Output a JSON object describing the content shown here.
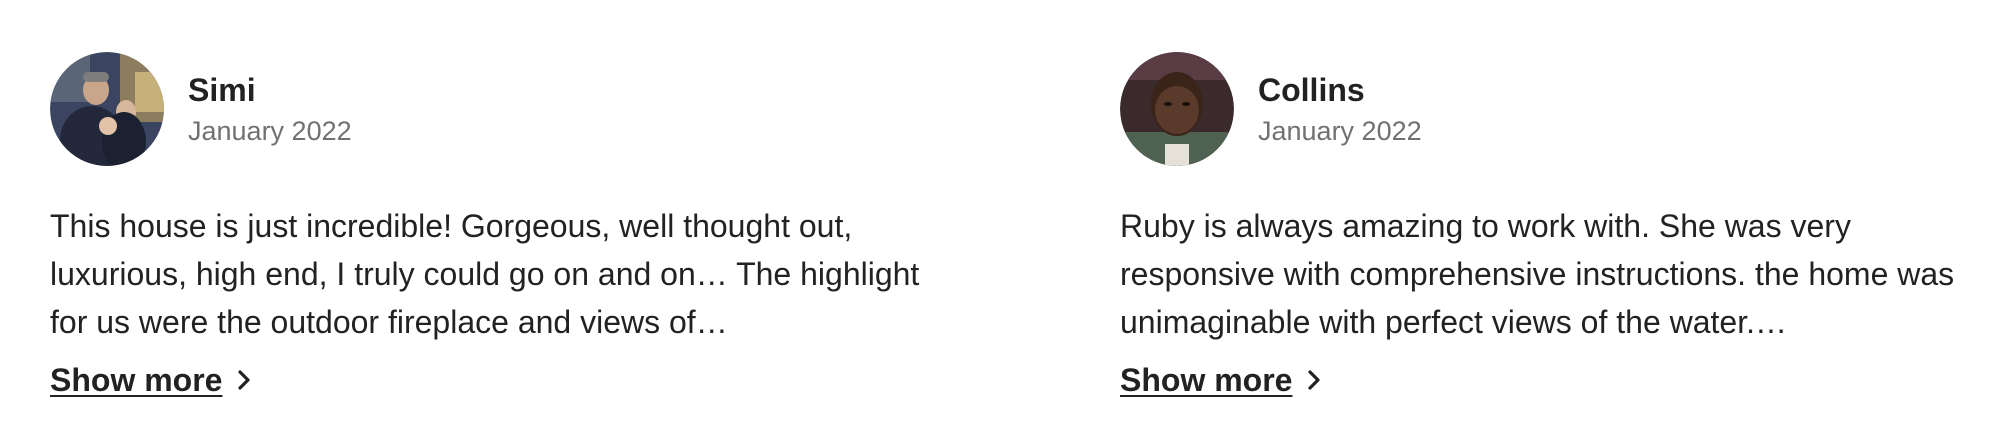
{
  "reviews": [
    {
      "name": "Simi",
      "date": "January 2022",
      "text": "This house is just incredible! Gorgeous, well thought out, luxurious, high end, I truly could go on and on… The highlight for us were the outdoor fireplace and views of…",
      "show_more_label": "Show more",
      "avatar": {
        "description": "profile photo",
        "colors": [
          "#2f3a55",
          "#8a7a5c",
          "#c7b37a",
          "#1c2333"
        ]
      }
    },
    {
      "name": "Collins",
      "date": "January 2022",
      "text": "Ruby is always amazing to work with. She was very responsive with comprehensive instructions. the home was unimaginable with perfect views of the water.…",
      "show_more_label": "Show more",
      "avatar": {
        "description": "profile photo",
        "colors": [
          "#3a2a22",
          "#6b4a3a",
          "#4e5f4e",
          "#d9d4cc"
        ]
      }
    }
  ],
  "icons": {
    "chevron": "chevron-right-icon"
  }
}
